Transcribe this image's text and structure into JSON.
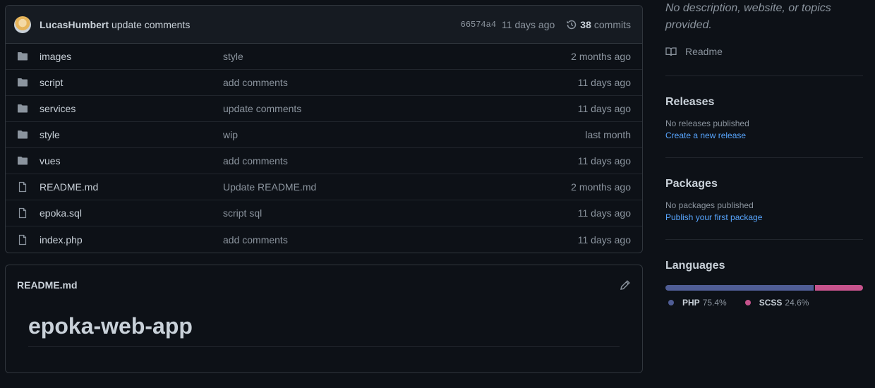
{
  "commit": {
    "author": "LucasHumbert",
    "message": "update comments",
    "sha": "66574a4",
    "age": "11 days ago",
    "count": "38",
    "count_label": "commits"
  },
  "files": [
    {
      "type": "dir",
      "name": "images",
      "message": "style",
      "age": "2 months ago"
    },
    {
      "type": "dir",
      "name": "script",
      "message": "add comments",
      "age": "11 days ago"
    },
    {
      "type": "dir",
      "name": "services",
      "message": "update comments",
      "age": "11 days ago"
    },
    {
      "type": "dir",
      "name": "style",
      "message": "wip",
      "age": "last month"
    },
    {
      "type": "dir",
      "name": "vues",
      "message": "add comments",
      "age": "11 days ago"
    },
    {
      "type": "file",
      "name": "README.md",
      "message": "Update README.md",
      "age": "2 months ago"
    },
    {
      "type": "file",
      "name": "epoka.sql",
      "message": "script sql",
      "age": "11 days ago"
    },
    {
      "type": "file",
      "name": "index.php",
      "message": "add comments",
      "age": "11 days ago"
    }
  ],
  "readme": {
    "filename": "README.md",
    "heading": "epoka-web-app"
  },
  "sidebar": {
    "about_desc": "No description, website, or topics provided.",
    "readme_label": "Readme",
    "releases": {
      "title": "Releases",
      "empty": "No releases published",
      "link": "Create a new release"
    },
    "packages": {
      "title": "Packages",
      "empty": "No packages published",
      "link": "Publish your first package"
    },
    "languages": {
      "title": "Languages",
      "items": [
        {
          "name": "PHP",
          "percent": "75.4%",
          "share": 75.4,
          "color": "#4F5D95"
        },
        {
          "name": "SCSS",
          "percent": "24.6%",
          "share": 24.6,
          "color": "#c6538c"
        }
      ]
    }
  }
}
